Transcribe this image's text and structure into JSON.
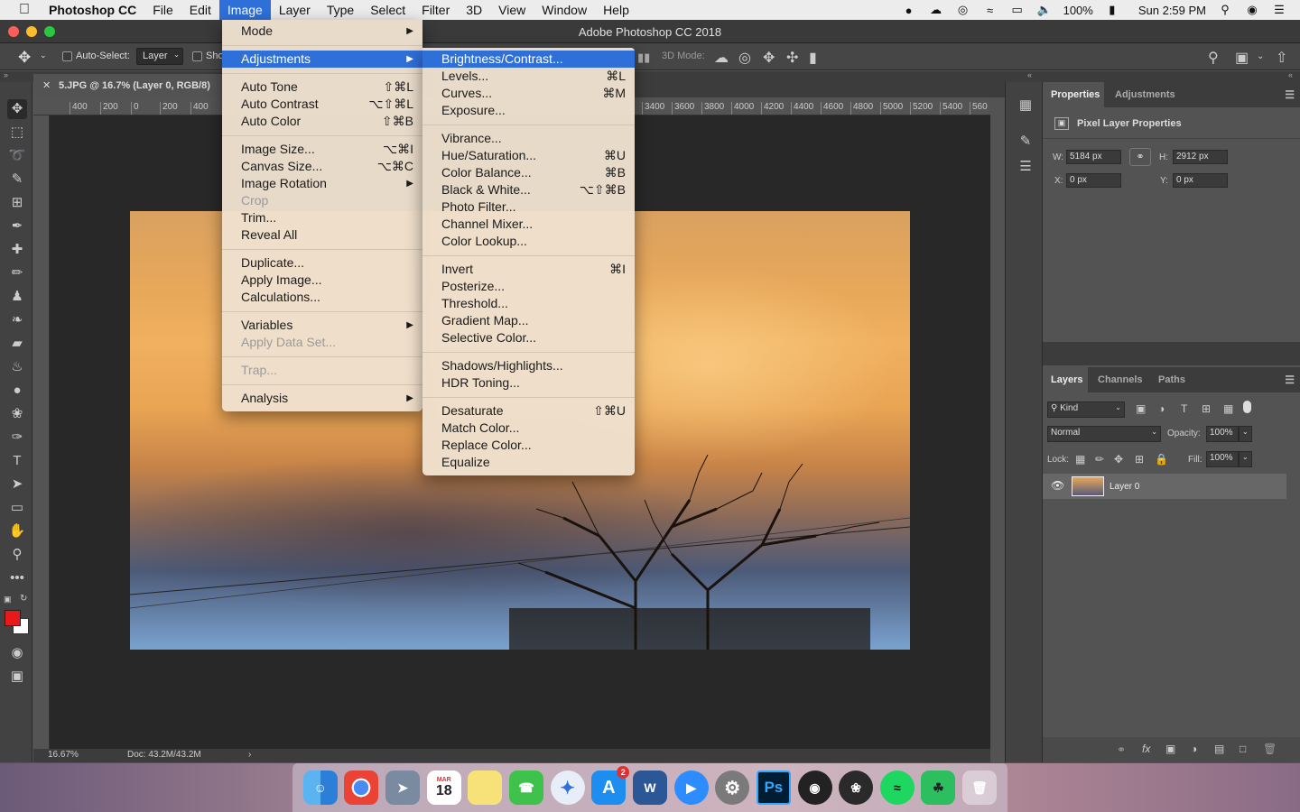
{
  "menubar": {
    "app": "Photoshop CC",
    "items": [
      "File",
      "Edit",
      "Image",
      "Layer",
      "Type",
      "Select",
      "Filter",
      "3D",
      "View",
      "Window",
      "Help"
    ],
    "battery": "100%",
    "clock": "Sun 2:59 PM"
  },
  "window": {
    "title": "Adobe Photoshop CC 2018"
  },
  "options": {
    "auto_select": "Auto-Select:",
    "layer_select": "Layer",
    "show": "Sho",
    "mode3d": "3D Mode:"
  },
  "document": {
    "tab": "5.JPG @ 16.7% (Layer 0, RGB/8)",
    "zoom": "16.67%",
    "doc_size": "Doc: 43.2M/43.2M",
    "ruler_left": [
      "400",
      "200",
      "0",
      "200",
      "400"
    ],
    "ruler_right": [
      "3400",
      "3600",
      "3800",
      "4000",
      "4200",
      "4400",
      "4600",
      "4800",
      "5000",
      "5200",
      "5400",
      "560"
    ]
  },
  "image_menu": {
    "items": [
      {
        "label": "Mode",
        "shortcut": "",
        "sub": true
      },
      {
        "label": "Adjustments",
        "shortcut": "",
        "sub": true,
        "highlight": true
      },
      {
        "label": "Auto Tone",
        "shortcut": "⇧⌘L"
      },
      {
        "label": "Auto Contrast",
        "shortcut": "⌥⇧⌘L"
      },
      {
        "label": "Auto Color",
        "shortcut": "⇧⌘B"
      },
      {
        "label": "Image Size...",
        "shortcut": "⌥⌘I"
      },
      {
        "label": "Canvas Size...",
        "shortcut": "⌥⌘C"
      },
      {
        "label": "Image Rotation",
        "shortcut": "",
        "sub": true
      },
      {
        "label": "Crop",
        "shortcut": "",
        "disabled": true
      },
      {
        "label": "Trim...",
        "shortcut": ""
      },
      {
        "label": "Reveal All",
        "shortcut": ""
      },
      {
        "label": "Duplicate...",
        "shortcut": ""
      },
      {
        "label": "Apply Image...",
        "shortcut": ""
      },
      {
        "label": "Calculations...",
        "shortcut": ""
      },
      {
        "label": "Variables",
        "shortcut": "",
        "sub": true
      },
      {
        "label": "Apply Data Set...",
        "shortcut": "",
        "disabled": true
      },
      {
        "label": "Trap...",
        "shortcut": "",
        "disabled": true
      },
      {
        "label": "Analysis",
        "shortcut": "",
        "sub": true
      }
    ]
  },
  "adjustments_menu": {
    "items": [
      {
        "label": "Brightness/Contrast...",
        "shortcut": "",
        "highlight": true
      },
      {
        "label": "Levels...",
        "shortcut": "⌘L"
      },
      {
        "label": "Curves...",
        "shortcut": "⌘M"
      },
      {
        "label": "Exposure...",
        "shortcut": ""
      },
      {
        "label": "Vibrance...",
        "shortcut": ""
      },
      {
        "label": "Hue/Saturation...",
        "shortcut": "⌘U"
      },
      {
        "label": "Color Balance...",
        "shortcut": "⌘B"
      },
      {
        "label": "Black & White...",
        "shortcut": "⌥⇧⌘B"
      },
      {
        "label": "Photo Filter...",
        "shortcut": ""
      },
      {
        "label": "Channel Mixer...",
        "shortcut": ""
      },
      {
        "label": "Color Lookup...",
        "shortcut": ""
      },
      {
        "label": "Invert",
        "shortcut": "⌘I"
      },
      {
        "label": "Posterize...",
        "shortcut": ""
      },
      {
        "label": "Threshold...",
        "shortcut": ""
      },
      {
        "label": "Gradient Map...",
        "shortcut": ""
      },
      {
        "label": "Selective Color...",
        "shortcut": ""
      },
      {
        "label": "Shadows/Highlights...",
        "shortcut": ""
      },
      {
        "label": "HDR Toning...",
        "shortcut": ""
      },
      {
        "label": "Desaturate",
        "shortcut": "⇧⌘U"
      },
      {
        "label": "Match Color...",
        "shortcut": ""
      },
      {
        "label": "Replace Color...",
        "shortcut": ""
      },
      {
        "label": "Equalize",
        "shortcut": ""
      }
    ]
  },
  "properties": {
    "tabs": [
      "Properties",
      "Adjustments"
    ],
    "header": "Pixel Layer Properties",
    "w_label": "W:",
    "w": "5184 px",
    "h_label": "H:",
    "h": "2912 px",
    "x_label": "X:",
    "x": "0 px",
    "y_label": "Y:",
    "y": "0 px"
  },
  "layers": {
    "tabs": [
      "Layers",
      "Channels",
      "Paths"
    ],
    "kind": "Kind",
    "blend": "Normal",
    "opacity_label": "Opacity:",
    "opacity": "100%",
    "lock_label": "Lock:",
    "fill_label": "Fill:",
    "fill": "100%",
    "layer_name": "Layer 0"
  },
  "dock": {
    "calendar_month": "MAR",
    "calendar_day": "18",
    "appstore_badge": "2",
    "word": "W",
    "ps": "Ps"
  },
  "colors": {
    "accent": "#2f6fd8",
    "foreground": "#e8191a",
    "background": "#ffffff"
  }
}
